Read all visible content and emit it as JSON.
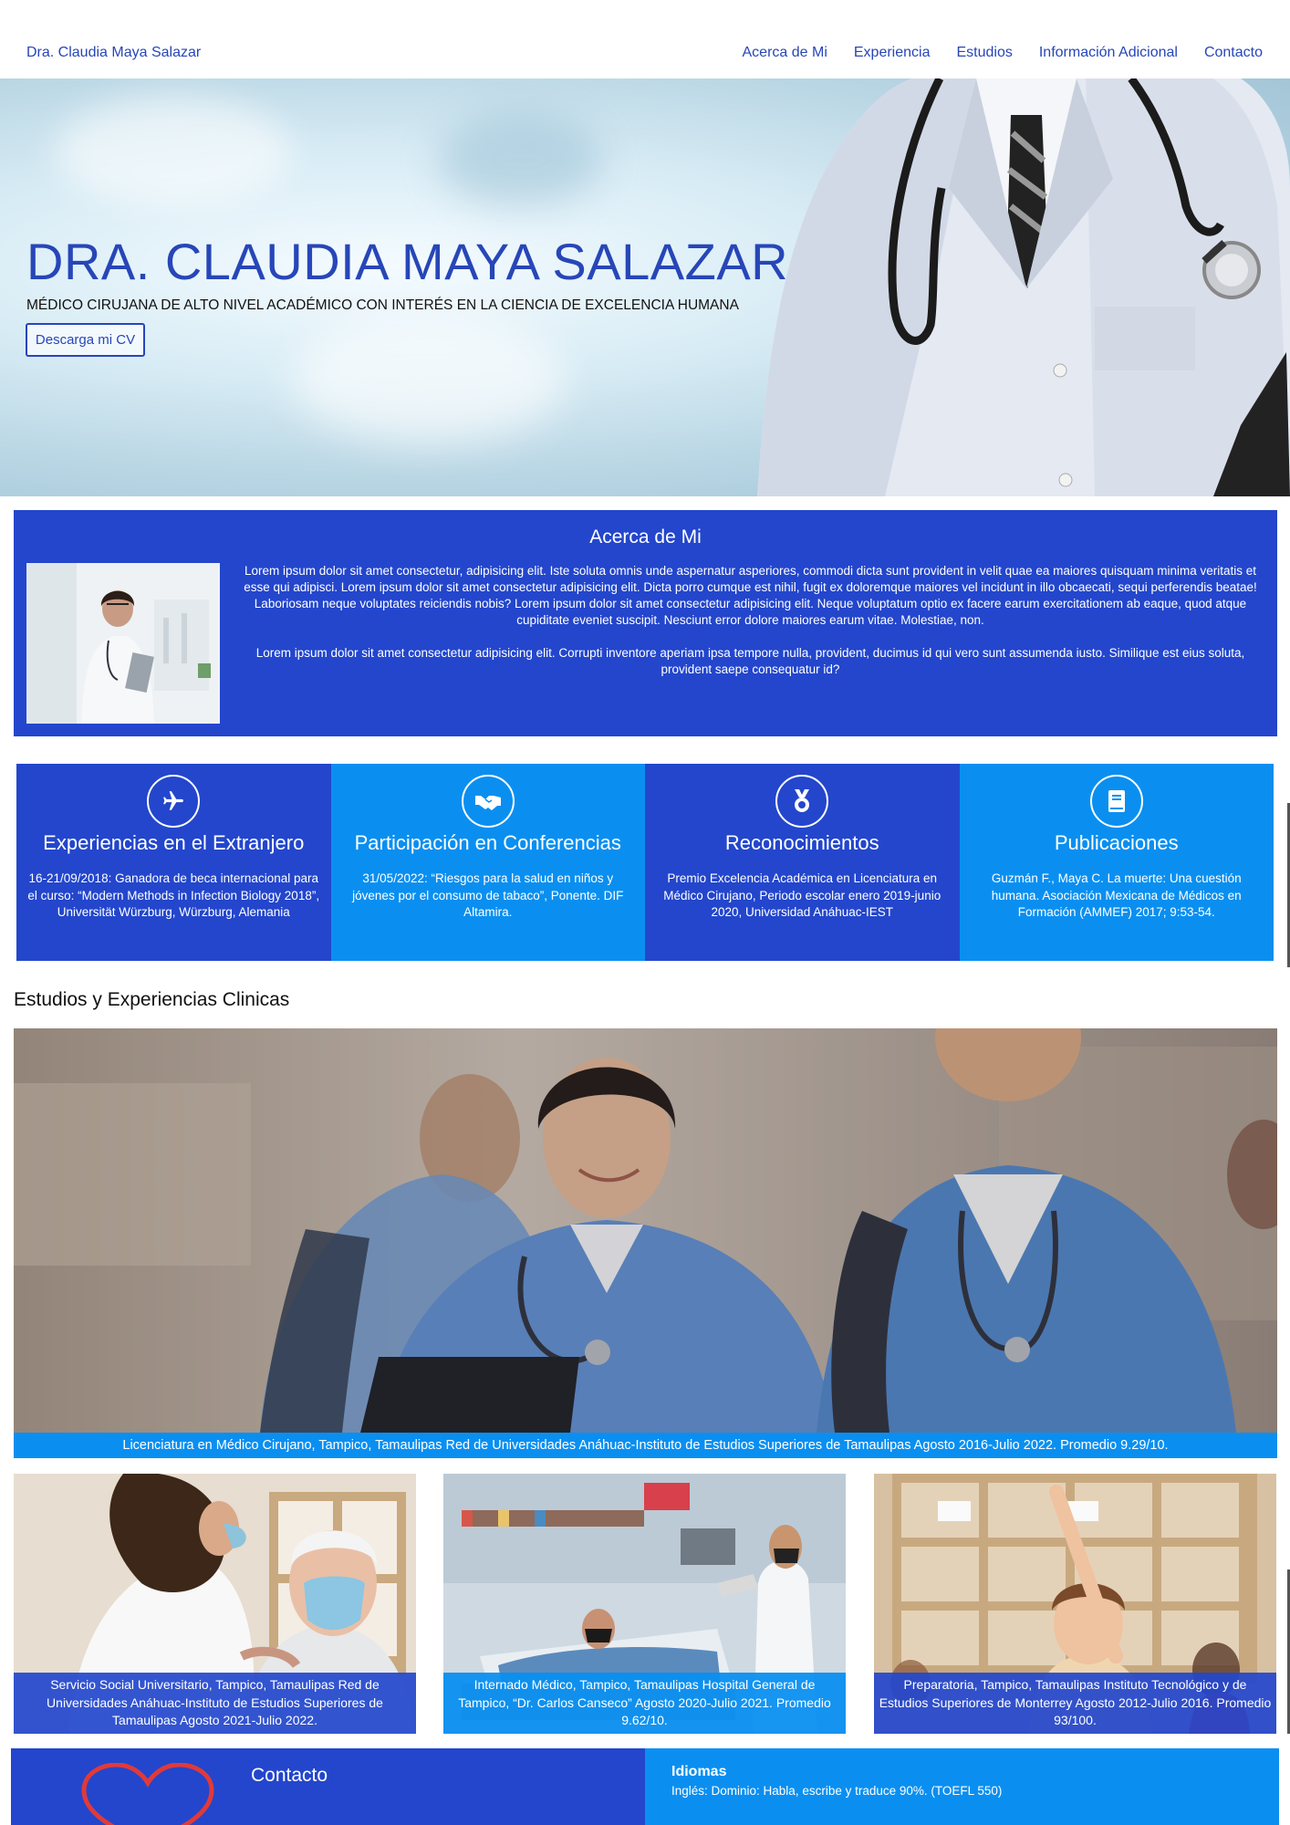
{
  "nav": {
    "brand": "Dra. Claudia Maya Salazar",
    "items": [
      "Acerca de Mi",
      "Experiencia",
      "Estudios",
      "Información Adicional",
      "Contacto"
    ]
  },
  "hero": {
    "title": "DRA. CLAUDIA MAYA SALAZAR",
    "subtitle": "MÉDICO CIRUJANA DE ALTO NIVEL ACADÉMICO CON INTERÉS EN LA CIENCIA DE EXCELENCIA HUMANA",
    "cv_button": "Descarga mi CV"
  },
  "about": {
    "title": "Acerca de Mi",
    "paragraph1": "Lorem ipsum dolor sit amet consectetur, adipisicing elit. Iste soluta omnis unde aspernatur asperiores, commodi dicta sunt provident in velit quae ea maiores quisquam minima veritatis et esse qui adipisci. Lorem ipsum dolor sit amet consectetur adipisicing elit. Dicta porro cumque est nihil, fugit ex doloremque maiores vel incidunt in illo obcaecati, sequi perferendis beatae! Laboriosam neque voluptates reiciendis nobis? Lorem ipsum dolor sit amet consectetur adipisicing elit. Neque voluptatum optio ex facere earum exercitationem ab eaque, quod atque cupiditate eveniet suscipit. Nesciunt error dolore maiores earum vitae. Molestiae, non.",
    "paragraph2": "Lorem ipsum dolor sit amet consectetur adipisicing elit. Corrupti inventore aperiam ipsa tempore nulla, provident, ducimus id qui vero sunt assumenda iusto. Similique est eius soluta, provident saepe consequatur id?"
  },
  "cards": [
    {
      "icon": "airplane-icon",
      "title": "Experiencias en el Extranjero",
      "text": "16-21/09/2018: Ganadora de beca internacional para el curso: “Modern Methods in Infection Biology 2018”, Universität Würzburg, Würzburg, Alemania"
    },
    {
      "icon": "handshake-icon",
      "title": "Participación en Conferencias",
      "text": "31/05/2022: “Riesgos para la salud en niños y jóvenes por el consumo de tabaco”, Ponente. DIF Altamira."
    },
    {
      "icon": "medal-icon",
      "title": "Reconocimientos",
      "text": "Premio Excelencia Académica en Licenciatura en Médico Cirujano, Periodo escolar enero 2019-junio 2020, Universidad Anáhuac-IEST"
    },
    {
      "icon": "book-icon",
      "title": "Publicaciones",
      "text": "Guzmán F., Maya C. La muerte: Una cuestión humana. Asociación Mexicana de Médicos en Formación (AMMEF) 2017; 9:53-54."
    }
  ],
  "studies": {
    "title": "Estudios y Experiencias Clinicas",
    "main_caption": "Licenciatura en Médico Cirujano, Tampico, Tamaulipas Red de Universidades Anáhuac-Instituto de Estudios Superiores de Tamaulipas Agosto 2016-Julio 2022. Promedio 9.29/10.",
    "items": [
      "Servicio Social Universitario, Tampico, Tamaulipas Red de Universidades Anáhuac-Instituto de Estudios Superiores de Tamaulipas Agosto 2021-Julio 2022.",
      "Internado Médico, Tampico, Tamaulipas Hospital General de Tampico, “Dr. Carlos Canseco” Agosto 2020-Julio 2021. Promedio 9.62/10.",
      "Preparatoria, Tampico, Tamaulipas Instituto Tecnológico y de Estudios Superiores de Monterrey Agosto 2012-Julio 2016. Promedio 93/100."
    ]
  },
  "footer": {
    "contact_title": "Contacto",
    "languages_title": "Idiomas",
    "languages_text": "Inglés: Dominio: Habla, escribe y traduce 90%. (TOEFL 550)"
  },
  "colors": {
    "primary": "#2346cc",
    "secondary": "#0a8ff0",
    "text_blue": "#2746b8"
  }
}
